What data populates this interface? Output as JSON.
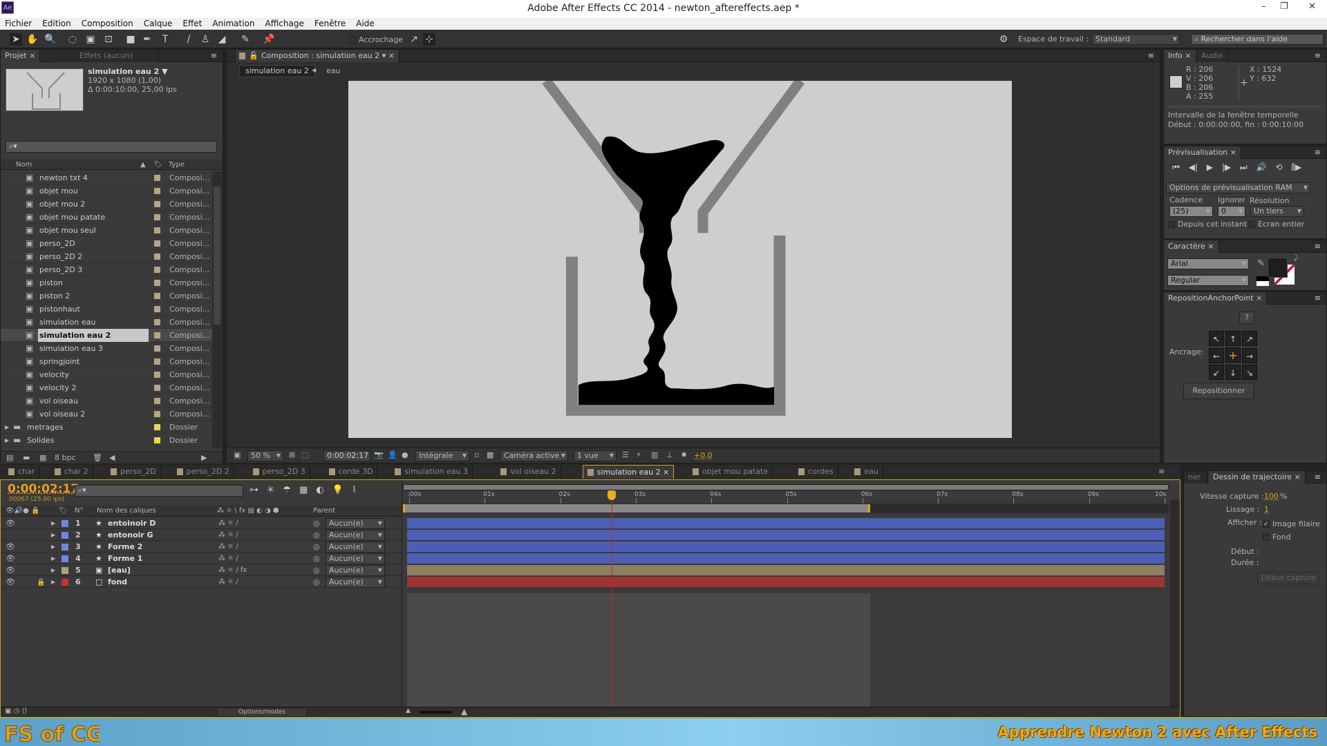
{
  "window": {
    "title": "Adobe After Effects CC 2014 - newton_aftereffects.aep *",
    "app_logo": "Ae"
  },
  "menu": [
    "Fichier",
    "Edition",
    "Composition",
    "Calque",
    "Effet",
    "Animation",
    "Affichage",
    "Fenêtre",
    "Aide"
  ],
  "toolbar": {
    "snap_label": "Accrochage",
    "workspace_label": "Espace de travail :",
    "workspace_value": "Standard",
    "help_placeholder": "Rechercher dans l'aide"
  },
  "project": {
    "tab": "Projet",
    "effects_tab": "Effets (aucun)",
    "selected_name": "simulation eau 2 ▼",
    "selected_size": "1920 x 1080 (1,00)",
    "selected_duration": "Δ 0:00:10:00, 25,00 ips",
    "col_name": "Nom",
    "col_type": "Type",
    "bpc": "8 bpc",
    "items": [
      {
        "name": "newton txt 4",
        "type": "Composi...",
        "kind": "comp"
      },
      {
        "name": "objet mou",
        "type": "Composi...",
        "kind": "comp"
      },
      {
        "name": "objet mou 2",
        "type": "Composi...",
        "kind": "comp"
      },
      {
        "name": "objet mou patate",
        "type": "Composi...",
        "kind": "comp"
      },
      {
        "name": "objet mou seul",
        "type": "Composi...",
        "kind": "comp"
      },
      {
        "name": "perso_2D",
        "type": "Composi...",
        "kind": "comp"
      },
      {
        "name": "perso_2D 2",
        "type": "Composi...",
        "kind": "comp"
      },
      {
        "name": "perso_2D 3",
        "type": "Composi...",
        "kind": "comp"
      },
      {
        "name": "piston",
        "type": "Composi...",
        "kind": "comp"
      },
      {
        "name": "piston 2",
        "type": "Composi...",
        "kind": "comp"
      },
      {
        "name": "pistonhaut",
        "type": "Composi...",
        "kind": "comp"
      },
      {
        "name": "simulation eau",
        "type": "Composi...",
        "kind": "comp"
      },
      {
        "name": "simulation eau 2",
        "type": "Composi...",
        "kind": "comp",
        "selected": true
      },
      {
        "name": "simulation eau 3",
        "type": "Composi...",
        "kind": "comp"
      },
      {
        "name": "springjoint",
        "type": "Composi...",
        "kind": "comp"
      },
      {
        "name": "velocity",
        "type": "Composi...",
        "kind": "comp"
      },
      {
        "name": "velocity 2",
        "type": "Composi...",
        "kind": "comp"
      },
      {
        "name": "vol oiseau",
        "type": "Composi...",
        "kind": "comp"
      },
      {
        "name": "vol oiseau 2",
        "type": "Composi...",
        "kind": "comp"
      },
      {
        "name": "metrages",
        "type": "Dossier",
        "kind": "folder"
      },
      {
        "name": "Solides",
        "type": "Dossier",
        "kind": "folder"
      }
    ]
  },
  "composition": {
    "tab": "Composition : simulation eau 2",
    "crumb_active": "simulation eau 2",
    "crumb_next": "eau",
    "zoom": "50 %",
    "timecode": "0:00:02:17",
    "resolution": "Intégrale",
    "camera": "Caméra active",
    "views": "1 vue",
    "exposure": "+0,0",
    "bg_color": "#cecece",
    "water_color": "#000000",
    "wall_color": "#808080"
  },
  "info": {
    "tab": "Info",
    "audio_tab": "Audio",
    "r": "R : 206",
    "v": "V : 206",
    "b": "B : 206",
    "a": "A : 255",
    "x": "X : 1524",
    "y": "Y : 632",
    "interval_title": "Intervalle de la fenêtre temporelle",
    "interval": "Début : 0:00:00:00, fin : 0:00:10:00"
  },
  "preview": {
    "tab": "Prévisualisation",
    "ram_options": "Options de prévisualisation RAM",
    "cadence_label": "Cadence",
    "cadence": "(25)",
    "skip_label": "Ignorer",
    "skip": "0",
    "resolution_label": "Résolution",
    "resolution": "Un tiers",
    "from_current": "Depuis cet instant",
    "fullscreen": "Ecran entier"
  },
  "character": {
    "tab": "Caractère",
    "font": "Arial",
    "style": "Regular"
  },
  "anchor": {
    "tab": "RepositionAnchorPoint",
    "help": "?",
    "label": "Ancrage:",
    "button": "Repositionner"
  },
  "timeline": {
    "tabs": [
      "char",
      "char 2",
      "perso_2D",
      "perso_2D 2",
      "perso_2D 3",
      "corde 3D",
      "simulation eau 3",
      "vol oiseau 2",
      "simulation eau 2",
      "objet mou patate",
      "cordes",
      "eau"
    ],
    "active_tab": 8,
    "timecode": "0:00:02:17",
    "frames": "00067 (25.00 ips)",
    "col_num": "N°",
    "col_name": "Nom des calques",
    "col_parent": "Parent",
    "options": "Options/modes",
    "ruler": [
      ":00s",
      "01s",
      "02s",
      "03s",
      "04s",
      "05s",
      "06s",
      "07s",
      "08s",
      "09s",
      "10s"
    ],
    "duration_s": 10,
    "current_s": 2.68,
    "work_end_s": 6.1,
    "layers": [
      {
        "num": "1",
        "name": "entoinoir D",
        "type": "shape",
        "label": "#6f86e0",
        "bar": "#4d5fb5",
        "visible": true,
        "locked": false,
        "parent": "Aucun(e)"
      },
      {
        "num": "2",
        "name": "entonoir G",
        "type": "shape",
        "label": "#6f86e0",
        "bar": "#4d5fb5",
        "visible": false,
        "locked": false,
        "parent": "Aucun(e)"
      },
      {
        "num": "3",
        "name": "Forme 2",
        "type": "shape",
        "label": "#6f86e0",
        "bar": "#4d5fb5",
        "visible": true,
        "locked": false,
        "parent": "Aucun(e)"
      },
      {
        "num": "4",
        "name": "Forme 1",
        "type": "shape",
        "label": "#6f86e0",
        "bar": "#4d5fb5",
        "visible": true,
        "locked": false,
        "parent": "Aucun(e)"
      },
      {
        "num": "5",
        "name": "[eau]",
        "type": "comp",
        "label": "#b0a080",
        "bar": "#8e7f63",
        "visible": true,
        "locked": false,
        "parent": "Aucun(e)",
        "fx": true
      },
      {
        "num": "6",
        "name": "fond",
        "type": "solid",
        "label": "#c83232",
        "bar": "#9e3434",
        "visible": true,
        "locked": true,
        "parent": "Aucun(e)"
      }
    ]
  },
  "motion_sketch": {
    "tab": "Dessin de trajectoire",
    "prev_tab": "ner",
    "speed_label": "Vitesse capture :",
    "speed": "100",
    "speed_unit": "%",
    "smooth_label": "Lissage :",
    "smooth": "1",
    "show_label": "Afficher :",
    "wireframe": "Image filaire",
    "background": "Fond",
    "start_label": "Début :",
    "duration_label": "Durée :",
    "button": "Début capture"
  },
  "banner": {
    "logo": "FS of CG",
    "text": "Apprendre Newton 2 avec After Effects"
  }
}
